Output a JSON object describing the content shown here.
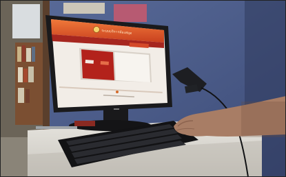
{
  "scene": {
    "colors": {
      "wall": "#4c5e8c",
      "screen_header": "#e0572a",
      "monitor_bezel": "#1a1a1c",
      "desk": "#dedcd6",
      "keyboard": "#121214",
      "hand": "#a87d65"
    },
    "monitor": {
      "header_text": "ระบบบริการห้องสมุด",
      "logo_icon": "emblem-icon"
    }
  }
}
